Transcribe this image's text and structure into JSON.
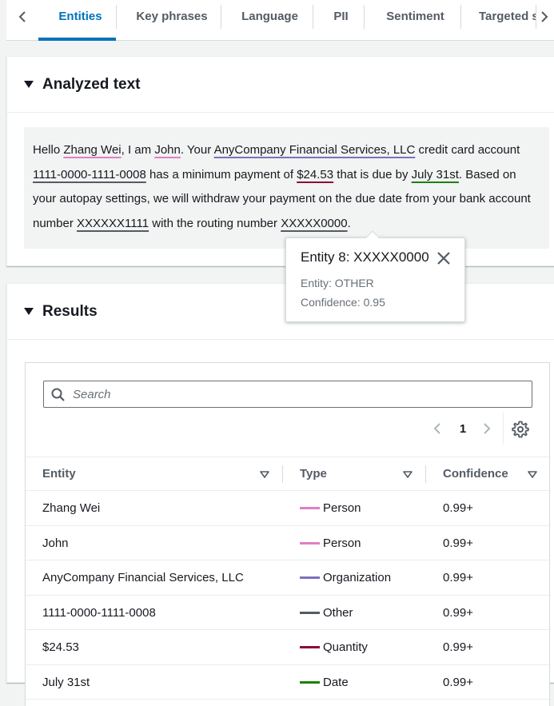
{
  "tabs": {
    "items": [
      "Entities",
      "Key phrases",
      "Language",
      "PII",
      "Sentiment",
      "Targeted sentiment"
    ],
    "active_index": 0
  },
  "analyzed_panel": {
    "title": "Analyzed text",
    "segments": [
      {
        "text": "Hello "
      },
      {
        "text": "Zhang Wei",
        "entity": true,
        "color": "#e07fc4"
      },
      {
        "text": ", I am "
      },
      {
        "text": "John",
        "entity": true,
        "color": "#e07fc4"
      },
      {
        "text": ". Your "
      },
      {
        "text": "AnyCompany Financial Services, LLC",
        "entity": true,
        "color": "#7d6fbf"
      },
      {
        "text": " credit card account "
      },
      {
        "text": "1111-0000-1111-0008",
        "entity": true,
        "color": "#545b64"
      },
      {
        "text": " has a minimum payment of "
      },
      {
        "text": "$24.53",
        "entity": true,
        "color": "#8b0a3b"
      },
      {
        "text": " that is due by "
      },
      {
        "text": "July 31st",
        "entity": true,
        "color": "#1d8102"
      },
      {
        "text": ". Based on your autopay settings, we will withdraw your payment on the due date from your bank account number "
      },
      {
        "text": "XXXXXX1111",
        "entity": true,
        "color": "#545b64"
      },
      {
        "text": " with the routing number "
      },
      {
        "text": "XXXXX0000",
        "entity": true,
        "color": "#545b64"
      },
      {
        "text": "."
      }
    ]
  },
  "popover": {
    "title": "Entity 8: XXXXX0000",
    "entity_line": "Entity: OTHER",
    "confidence_line": "Confidence: 0.95"
  },
  "results_panel": {
    "title": "Results",
    "search_placeholder": "Search",
    "page_number": "1",
    "columns": [
      "Entity",
      "Type",
      "Confidence"
    ],
    "rows": [
      {
        "entity": "Zhang Wei",
        "type": "Person",
        "color": "#e07fc4",
        "confidence": "0.99+"
      },
      {
        "entity": "John",
        "type": "Person",
        "color": "#e07fc4",
        "confidence": "0.99+"
      },
      {
        "entity": "AnyCompany Financial Services, LLC",
        "type": "Organization",
        "color": "#7d6fbf",
        "confidence": "0.99+"
      },
      {
        "entity": "1111-0000-1111-0008",
        "type": "Other",
        "color": "#545b64",
        "confidence": "0.99+"
      },
      {
        "entity": "$24.53",
        "type": "Quantity",
        "color": "#8b0a3b",
        "confidence": "0.99+"
      },
      {
        "entity": "July 31st",
        "type": "Date",
        "color": "#1d8102",
        "confidence": "0.99+"
      }
    ]
  }
}
